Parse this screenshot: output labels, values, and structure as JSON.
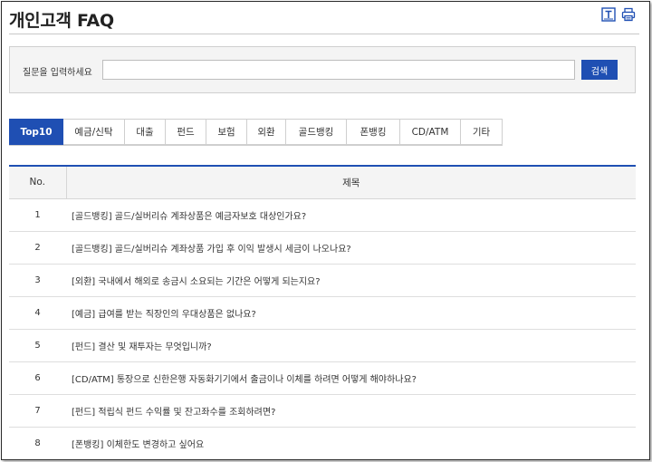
{
  "header": {
    "title": "개인고객 FAQ",
    "icons": [
      "text-size-icon",
      "print-icon"
    ]
  },
  "search": {
    "label": "질문을 입력하세요",
    "value": "",
    "placeholder": "",
    "button_label": "검색"
  },
  "tabs": [
    {
      "label": "Top10",
      "active": true
    },
    {
      "label": "예금/신탁",
      "active": false
    },
    {
      "label": "대출",
      "active": false
    },
    {
      "label": "펀드",
      "active": false
    },
    {
      "label": "보험",
      "active": false
    },
    {
      "label": "외환",
      "active": false
    },
    {
      "label": "골드뱅킹",
      "active": false
    },
    {
      "label": "폰뱅킹",
      "active": false
    },
    {
      "label": "CD/ATM",
      "active": false
    },
    {
      "label": "기타",
      "active": false
    }
  ],
  "table": {
    "columns": [
      "No.",
      "제목"
    ],
    "rows": [
      {
        "no": "1",
        "subject": "[골드뱅킹] 골드/실버리슈 계좌상품은 예금자보호 대상인가요?"
      },
      {
        "no": "2",
        "subject": "[골드뱅킹] 골드/실버리슈 계좌상품 가입 후 이익 발생시 세금이 나오나요?"
      },
      {
        "no": "3",
        "subject": "[외환] 국내에서 해외로 송금시 소요되는 기간은 어떻게 되는지요?"
      },
      {
        "no": "4",
        "subject": "[예금] 급여를 받는 직장인의 우대상품은 없나요?"
      },
      {
        "no": "5",
        "subject": "[펀드] 결산 및 재투자는 무엇입니까?"
      },
      {
        "no": "6",
        "subject": "[CD/ATM] 통장으로 신한은행 자동화기기에서 출금이나 이체를 하려면 어떻게 해야하나요?"
      },
      {
        "no": "7",
        "subject": "[펀드] 적립식 펀드 수익률 및 잔고좌수를 조회하려면?"
      },
      {
        "no": "8",
        "subject": "[폰뱅킹] 이체한도 변경하고 싶어요"
      }
    ]
  },
  "colors": {
    "accent": "#1f4fb3",
    "panel_bg": "#f4f4f4",
    "border": "#cfcfcf"
  }
}
